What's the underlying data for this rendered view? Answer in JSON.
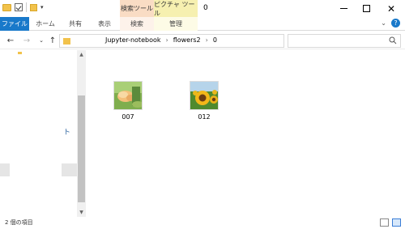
{
  "window": {
    "title": "0",
    "context_tabs": {
      "search_tools": "検索ツール",
      "picture_tools": "ピクチャ ツール"
    }
  },
  "ribbon": {
    "tabs": [
      {
        "label": "ファイル"
      },
      {
        "label": "ホーム"
      },
      {
        "label": "共有"
      },
      {
        "label": "表示"
      },
      {
        "label": "検索"
      },
      {
        "label": "管理"
      }
    ]
  },
  "address_bar": {
    "breadcrumbs": [
      "Jupyter-notebook",
      "flowers2",
      "0"
    ],
    "search_placeholder": ""
  },
  "nav_pane": {
    "visible_label": "ト"
  },
  "files": [
    {
      "name": "007",
      "thumbnail": "flower-photo-thumbnail"
    },
    {
      "name": "012",
      "thumbnail": "sunflower-photo-thumbnail"
    }
  ],
  "status_bar": {
    "text": "2 個の項目"
  },
  "colors": {
    "accent": "#1979ca",
    "search_context": "#f9dcc4",
    "picture_context": "#f6f0b0"
  }
}
